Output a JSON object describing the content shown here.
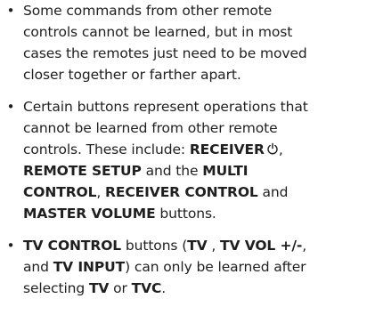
{
  "bullet_glyph": "•",
  "notes": [
    {
      "lines": [
        "Some commands from other remote",
        "controls cannot be learned, but in most",
        "cases the remotes just need to be moved",
        "closer together or farther apart."
      ]
    },
    {
      "l1": "Certain buttons represent operations that",
      "l2": "cannot be learned from other remote",
      "l3_text": "controls. These include: ",
      "receiver": "RECEIVER",
      "power_icon": "power-icon",
      "comma": ",",
      "remote_setup": "REMOTE SETUP",
      "and_the": " and the ",
      "multi": "MULTI",
      "control": "CONTROL",
      "comma_space": ", ",
      "receiver_control": "RECEIVER CONTROL",
      "and": " and",
      "master_volume": "MASTER VOLUME",
      "buttons": " buttons."
    },
    {
      "tv_control": "TV CONTROL",
      "buttons_paren": " buttons (",
      "tv": "TV",
      "space_comma": " , ",
      "tv_vol": "TV VOL +/-",
      "comma": ",",
      "and_word": "and ",
      "tv_input": "TV INPUT",
      "can_only": ") can only be learned after",
      "selecting": "selecting ",
      "tv2": "TV",
      "or": " or ",
      "tvc": "TVC",
      "period": "."
    }
  ]
}
